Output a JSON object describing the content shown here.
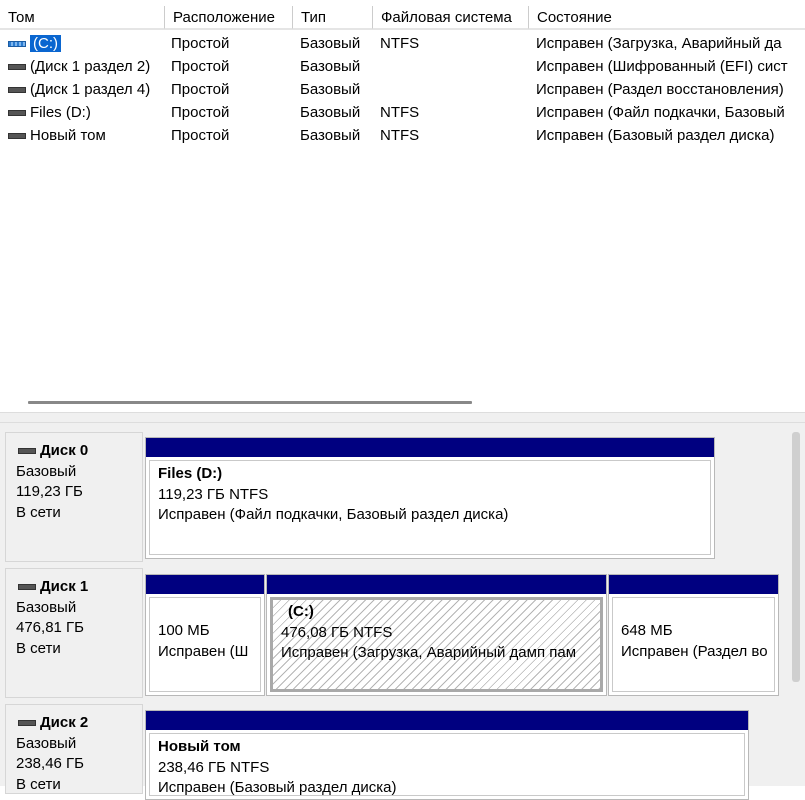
{
  "volume_list": {
    "columns": [
      "Том",
      "Расположение",
      "Тип",
      "Файловая система",
      "Состояние"
    ],
    "rows": [
      {
        "name": "(C:)",
        "icon": "system-volume-icon",
        "selected": true,
        "layout": "Простой",
        "type": "Базовый",
        "fs": "NTFS",
        "status": "Исправен (Загрузка, Аварийный да"
      },
      {
        "name": "(Диск 1 раздел 2)",
        "icon": "volume-icon",
        "layout": "Простой",
        "type": "Базовый",
        "fs": "",
        "status": "Исправен (Шифрованный (EFI) сист"
      },
      {
        "name": "(Диск 1 раздел 4)",
        "icon": "volume-icon",
        "layout": "Простой",
        "type": "Базовый",
        "fs": "",
        "status": "Исправен (Раздел восстановления)"
      },
      {
        "name": "Files (D:)",
        "icon": "volume-icon",
        "layout": "Простой",
        "type": "Базовый",
        "fs": "NTFS",
        "status": "Исправен (Файл подкачки, Базовый"
      },
      {
        "name": "Новый том",
        "icon": "volume-icon",
        "layout": "Простой",
        "type": "Базовый",
        "fs": "NTFS",
        "status": "Исправен (Базовый раздел диска)"
      }
    ]
  },
  "disks": [
    {
      "name": "Диск 0",
      "kind": "Базовый",
      "size": "119,23 ГБ",
      "state": "В сети",
      "partitions": [
        {
          "title": "Files  (D:)",
          "size": "119,23 ГБ NTFS",
          "status": "Исправен (Файл подкачки, Базовый раздел диска)"
        }
      ]
    },
    {
      "name": "Диск 1",
      "kind": "Базовый",
      "size": "476,81 ГБ",
      "state": "В сети",
      "partitions": [
        {
          "title": "",
          "size": "100 МБ",
          "status": "Исправен (Ш"
        },
        {
          "title": "(C:)",
          "size": "476,08 ГБ NTFS",
          "status": "Исправен (Загрузка, Аварийный дамп пам",
          "selected": true
        },
        {
          "title": "",
          "size": "648 МБ",
          "status": "Исправен (Раздел во"
        }
      ]
    },
    {
      "name": "Диск 2",
      "kind": "Базовый",
      "size": "238,46 ГБ",
      "state": "В сети",
      "partitions": [
        {
          "title": "Новый том",
          "size": "238,46 ГБ NTFS",
          "status": "Исправен (Базовый раздел диска)"
        }
      ]
    }
  ],
  "colors": {
    "partition_bar": "#000080",
    "selection": "#0a66d0"
  }
}
